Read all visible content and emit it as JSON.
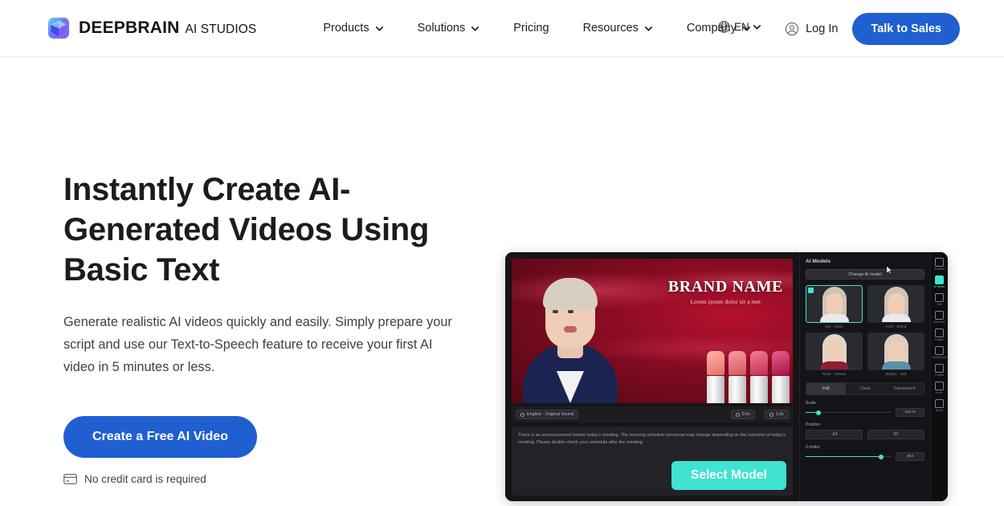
{
  "brand": {
    "name": "DEEPBRAIN",
    "sub": "AI STUDIOS",
    "logo_icon": "cube-logo-icon"
  },
  "header": {
    "nav": [
      {
        "label": "Products",
        "has_chevron": true,
        "icon": "chevron-down-icon"
      },
      {
        "label": "Solutions",
        "has_chevron": true,
        "icon": "chevron-down-icon"
      },
      {
        "label": "Pricing",
        "has_chevron": false,
        "icon": ""
      },
      {
        "label": "Resources",
        "has_chevron": true,
        "icon": "chevron-down-icon"
      },
      {
        "label": "Company",
        "has_chevron": true,
        "icon": "chevron-down-icon"
      }
    ],
    "language": {
      "label": "EN",
      "icon": "globe-icon"
    },
    "login": {
      "label": "Log In",
      "icon": "user-circle-icon"
    },
    "talk_to_sales": "Talk to Sales"
  },
  "hero": {
    "headline": "Instantly Create AI-Generated Videos Using Basic Text",
    "subtext": "Generate realistic AI videos quickly and easily. Simply prepare your script and use our Text-to-Speech feature to receive your first AI video in 5 minutes or less.",
    "cta_label": "Create a Free AI Video",
    "no_card_note": "No credit card is required",
    "no_card_icon": "credit-card-icon"
  },
  "mockup": {
    "stage": {
      "brand_title": "BRAND NAME",
      "brand_subtitle": "Lorem ipsum dolor sit a met"
    },
    "video_bar": {
      "language_chip": "English - Original Sound",
      "time_chips": [
        "0.5s",
        "1.0s"
      ]
    },
    "script_text": "There is an announcement before today's meeting. The morning schedule tomorrow may change depending on the outcome of today's meeting. Please double-check your schedule after the meeting.",
    "select_model_label": "Select Model",
    "panel": {
      "title": "AI Models",
      "change_button": "Change AI model",
      "models": [
        {
          "label": "Mia · Smile",
          "selected": true
        },
        {
          "label": "Ariel · Stand",
          "selected": false
        },
        {
          "label": "Rose · Casual",
          "selected": false
        },
        {
          "label": "Sophie · Knit",
          "selected": false
        }
      ],
      "tabs": [
        {
          "label": "Full",
          "active": true
        },
        {
          "label": "Chest",
          "active": false
        },
        {
          "label": "Transparent",
          "active": false
        }
      ],
      "controls": [
        {
          "name": "Scale",
          "value": "141 %",
          "fill_pct": 14
        },
        {
          "name": "Position",
          "x": "-24",
          "y": "67"
        },
        {
          "name": "Z-Index",
          "value": "404",
          "fill_pct": 88
        }
      ]
    },
    "rail": [
      {
        "label": "Template",
        "active": false,
        "icon": "template-icon"
      },
      {
        "label": "AI Model",
        "active": true,
        "icon": "ai-model-icon"
      },
      {
        "label": "Text",
        "active": false,
        "icon": "text-icon"
      },
      {
        "label": "Elements",
        "active": false,
        "icon": "elements-icon"
      },
      {
        "label": "Images",
        "active": false,
        "icon": "image-icon"
      },
      {
        "label": "Background",
        "active": false,
        "icon": "background-icon"
      },
      {
        "label": "Frames",
        "active": false,
        "icon": "frames-icon"
      },
      {
        "label": "Audio",
        "active": false,
        "icon": "audio-icon"
      },
      {
        "label": "Brand",
        "active": false,
        "icon": "brand-icon"
      }
    ]
  },
  "colors": {
    "brand_blue": "#1f5fd0",
    "accent_teal": "#3fe3d0",
    "text_dark": "#1a1c20"
  }
}
